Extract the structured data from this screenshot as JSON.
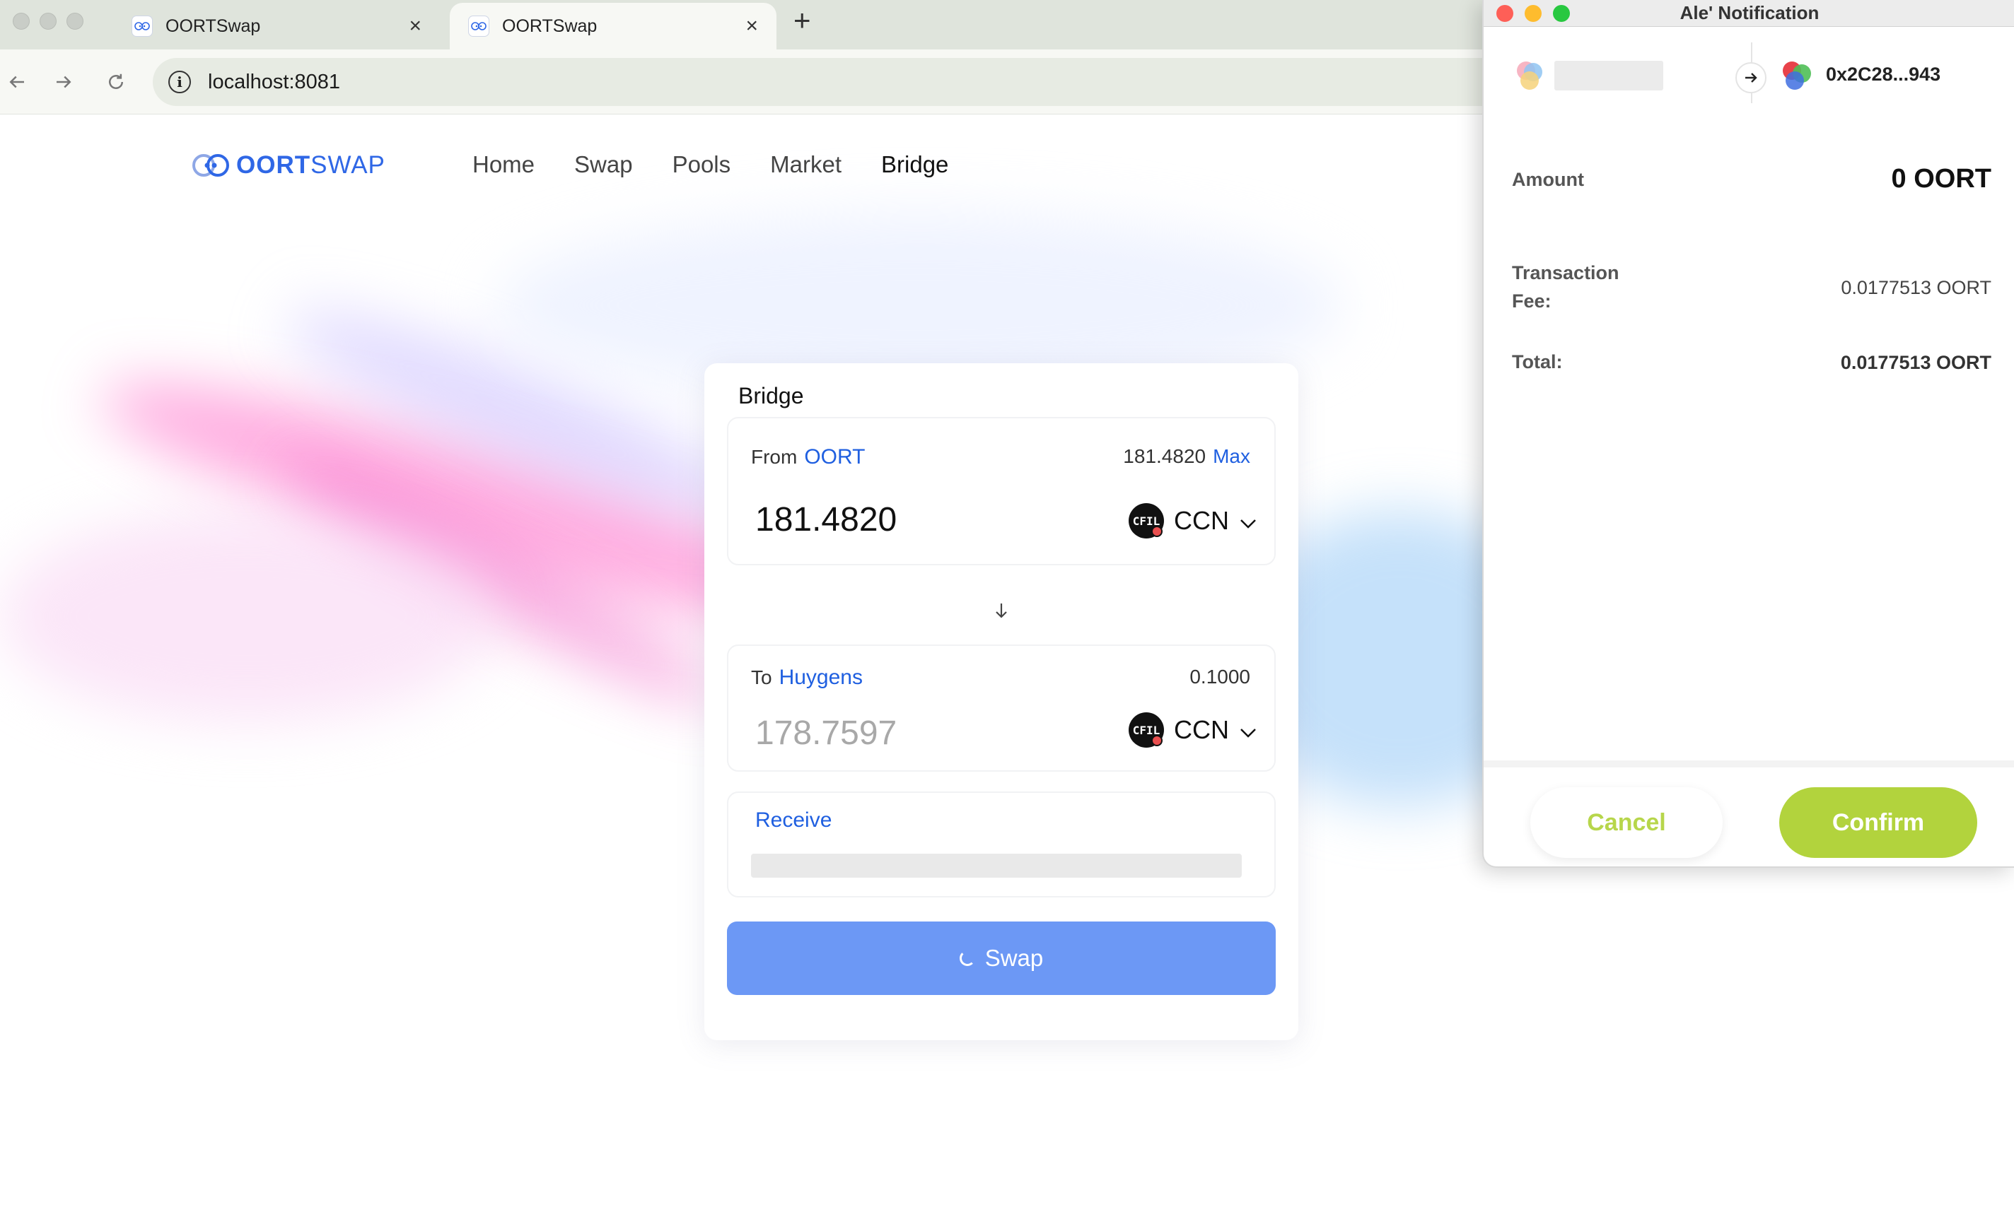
{
  "browser": {
    "tabs": [
      {
        "title": "OORTSwap",
        "active": false
      },
      {
        "title": "OORTSwap",
        "active": true
      }
    ],
    "url": "localhost:8081"
  },
  "site": {
    "logo_bold": "OORT",
    "logo_light": "SWAP",
    "nav": [
      "Home",
      "Swap",
      "Pools",
      "Market",
      "Bridge"
    ],
    "active_nav": "Bridge"
  },
  "bridge": {
    "title": "Bridge",
    "from": {
      "label": "From",
      "network": "OORT",
      "balance": "181.4820",
      "max_label": "Max",
      "amount": "181.4820",
      "token": "CCN"
    },
    "to": {
      "label": "To",
      "network": "Huygens",
      "balance": "0.1000",
      "amount": "178.7597",
      "token": "CCN"
    },
    "receive_label": "Receive",
    "swap_label": "Swap"
  },
  "wallet_popup": {
    "window_title": "Ale' Notification",
    "to_address": "0x2C28...943",
    "amount_label": "Amount",
    "amount_value": "0 OORT",
    "fee_label_1": "Transaction",
    "fee_label_2": "Fee:",
    "fee_value": "0.0177513 OORT",
    "total_label": "Total:",
    "total_value": "0.0177513 OORT",
    "cancel_label": "Cancel",
    "confirm_label": "Confirm"
  },
  "colors": {
    "brand_blue": "#2f67e6",
    "swap_button": "#6c98f5",
    "confirm_green": "#b2d33d"
  }
}
